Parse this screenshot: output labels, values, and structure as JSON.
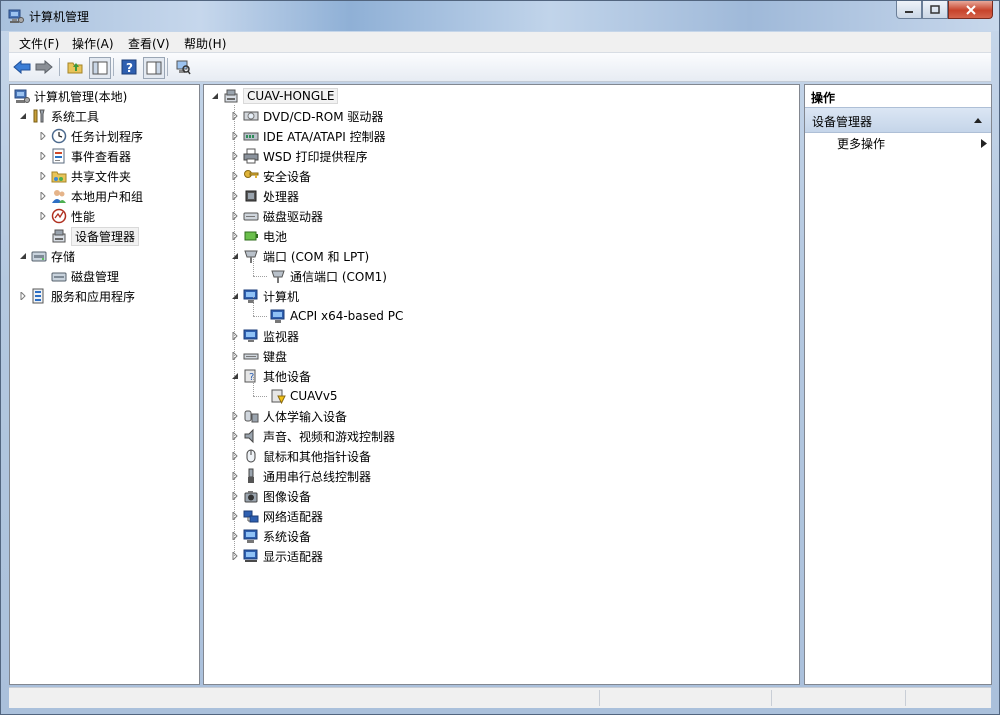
{
  "window": {
    "title": "计算机管理"
  },
  "menu": [
    "文件(F)",
    "操作(A)",
    "查看(V)",
    "帮助(H)"
  ],
  "toolbar_icons": [
    "back-arrow-icon",
    "forward-arrow-icon",
    "up-folder-icon",
    "show-hide-tree-icon",
    "help-icon",
    "show-hide-action-pane-icon",
    "scan-hardware-icon"
  ],
  "left_tree": {
    "root": "计算机管理(本地)",
    "system_tools": "系统工具",
    "task_scheduler": "任务计划程序",
    "event_viewer": "事件查看器",
    "shared_folders": "共享文件夹",
    "local_users": "本地用户和组",
    "performance": "性能",
    "device_manager": "设备管理器",
    "storage": "存储",
    "disk_management": "磁盘管理",
    "services_apps": "服务和应用程序"
  },
  "device_tree": {
    "root": "CUAV-HONGLE",
    "items": [
      {
        "label": "DVD/CD-ROM 驱动器",
        "icon": "dvd-drive-icon"
      },
      {
        "label": "IDE ATA/ATAPI 控制器",
        "icon": "ide-controller-icon"
      },
      {
        "label": "WSD 打印提供程序",
        "icon": "printer-icon"
      },
      {
        "label": "安全设备",
        "icon": "security-key-icon"
      },
      {
        "label": "处理器",
        "icon": "processor-icon"
      },
      {
        "label": "磁盘驱动器",
        "icon": "disk-drive-icon"
      },
      {
        "label": "电池",
        "icon": "battery-icon"
      },
      {
        "label": "端口 (COM 和 LPT)",
        "icon": "port-icon",
        "expanded": true
      },
      {
        "label": "通信端口 (COM1)",
        "icon": "port-icon",
        "child": true
      },
      {
        "label": "计算机",
        "icon": "computer-icon",
        "expanded": true
      },
      {
        "label": "ACPI x64-based PC",
        "icon": "computer-icon",
        "child": true
      },
      {
        "label": "监视器",
        "icon": "monitor-icon"
      },
      {
        "label": "键盘",
        "icon": "keyboard-icon"
      },
      {
        "label": "其他设备",
        "icon": "unknown-device-icon",
        "expanded": true
      },
      {
        "label": "CUAVv5",
        "icon": "warning-device-icon",
        "child": true
      },
      {
        "label": "人体学输入设备",
        "icon": "hid-icon"
      },
      {
        "label": "声音、视频和游戏控制器",
        "icon": "speaker-icon"
      },
      {
        "label": "鼠标和其他指针设备",
        "icon": "mouse-icon"
      },
      {
        "label": "通用串行总线控制器",
        "icon": "usb-icon"
      },
      {
        "label": "图像设备",
        "icon": "camera-icon"
      },
      {
        "label": "网络适配器",
        "icon": "network-adapter-icon"
      },
      {
        "label": "系统设备",
        "icon": "system-device-icon"
      },
      {
        "label": "显示适配器",
        "icon": "display-adapter-icon"
      }
    ]
  },
  "actions": {
    "header": "操作",
    "section": "设备管理器",
    "more": "更多操作"
  },
  "colors": {
    "accent": "#c5d5e9",
    "selection": "#f2f2f2"
  }
}
